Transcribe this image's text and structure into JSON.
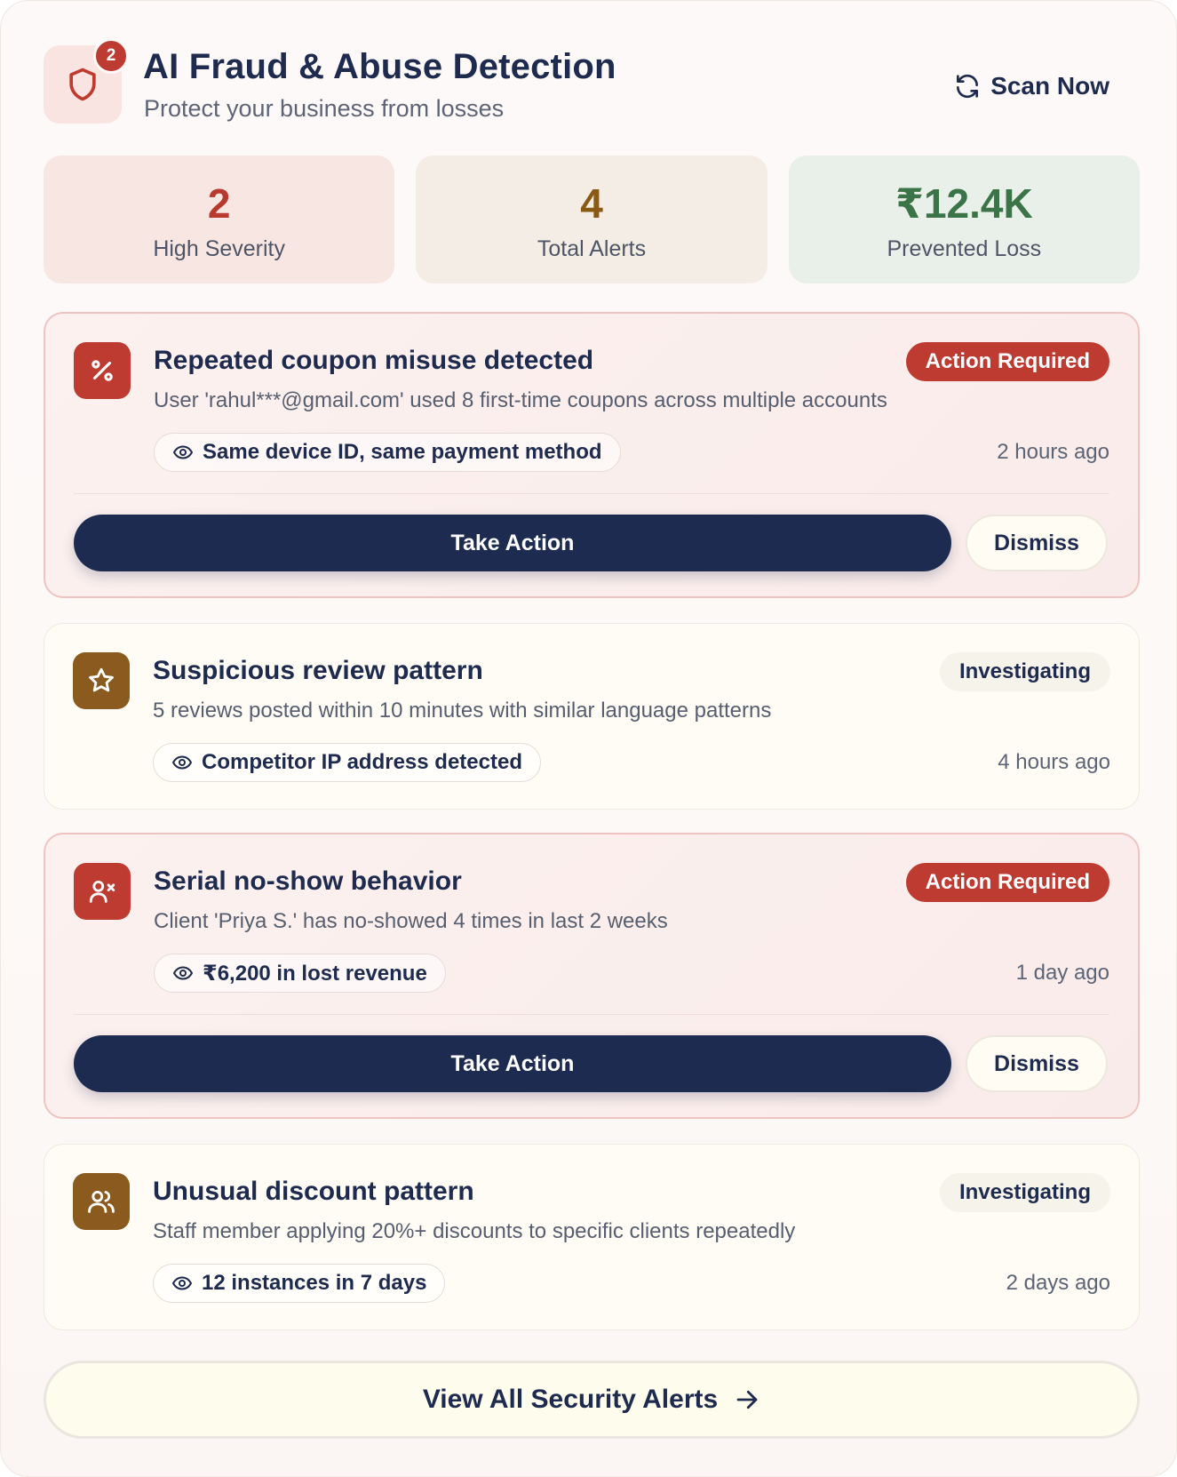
{
  "header": {
    "badge_count": "2",
    "title": "AI Fraud & Abuse Detection",
    "subtitle": "Protect your business from losses",
    "scan_label": "Scan Now"
  },
  "stats": [
    {
      "value": "2",
      "label": "High Severity",
      "color": "#b8392e"
    },
    {
      "value": "4",
      "label": "Total Alerts",
      "color": "#8a5a14"
    },
    {
      "value": "₹12.4K",
      "label": "Prevented Loss",
      "color": "#3b7447"
    }
  ],
  "alerts": [
    {
      "icon": "percent-icon",
      "title": "Repeated coupon misuse detected",
      "description": "User 'rahul***@gmail.com' used 8 first-time coupons across multiple accounts",
      "status": "Action Required",
      "evidence": "Same device ID, same payment method",
      "time": "2 hours ago",
      "primary_action": "Take Action",
      "secondary_action": "Dismiss"
    },
    {
      "icon": "star-icon",
      "title": "Suspicious review pattern",
      "description": "5 reviews posted within 10 minutes with similar language patterns",
      "status": "Investigating",
      "evidence": "Competitor IP address detected",
      "time": "4 hours ago"
    },
    {
      "icon": "user-x-icon",
      "title": "Serial no-show behavior",
      "description": "Client 'Priya S.' has no-showed 4 times in last 2 weeks",
      "status": "Action Required",
      "evidence": "₹6,200 in lost revenue",
      "time": "1 day ago",
      "primary_action": "Take Action",
      "secondary_action": "Dismiss"
    },
    {
      "icon": "users-icon",
      "title": "Unusual discount pattern",
      "description": "Staff member applying 20%+ discounts to specific clients repeatedly",
      "status": "Investigating",
      "evidence": "12 instances in 7 days",
      "time": "2 days ago"
    }
  ],
  "footer": {
    "view_all_label": "View All Security Alerts"
  },
  "colors": {
    "navy": "#1e2b50",
    "danger": "#bd3b30",
    "amber": "#8b5a1e",
    "success": "#3b7447"
  }
}
